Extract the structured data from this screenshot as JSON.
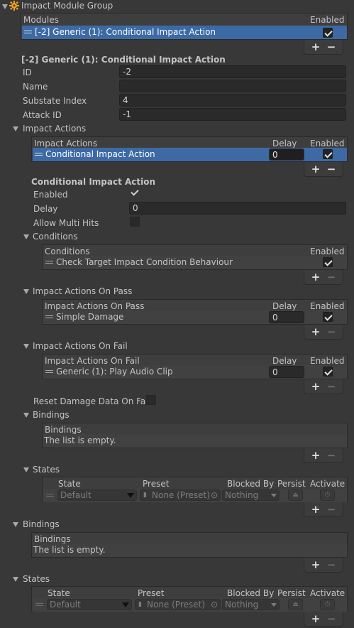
{
  "root": {
    "title": "Impact Module Group"
  },
  "modules": {
    "header": "Modules",
    "enabled_header": "Enabled",
    "items": [
      {
        "label": "[-2] Generic (1): Conditional Impact Action",
        "enabled": true
      }
    ]
  },
  "module_detail": {
    "title": "[-2] Generic (1): Conditional Impact Action",
    "fields": [
      {
        "label": "ID",
        "value": "-2"
      },
      {
        "label": "Name",
        "value": ""
      },
      {
        "label": "Substate Index",
        "value": "4"
      },
      {
        "label": "Attack ID",
        "value": "-1"
      }
    ]
  },
  "impact_actions": {
    "label": "Impact Actions",
    "header": "Impact Actions",
    "delay_header": "Delay",
    "enabled_header": "Enabled",
    "items": [
      {
        "label": "Conditional Impact Action",
        "delay": "0",
        "enabled": true
      }
    ]
  },
  "conditional_action": {
    "title": "Conditional Impact Action",
    "enabled_label": "Enabled",
    "enabled": true,
    "delay_label": "Delay",
    "delay_value": "0",
    "allow_multi_hits_label": "Allow Multi Hits",
    "allow_multi_hits": false
  },
  "conditions": {
    "label": "Conditions",
    "header": "Conditions",
    "enabled_header": "Enabled",
    "items": [
      {
        "label": "Check Target Impact Condition Behaviour",
        "enabled": true
      }
    ]
  },
  "on_pass": {
    "label": "Impact Actions On Pass",
    "header": "Impact Actions On Pass",
    "delay_header": "Delay",
    "enabled_header": "Enabled",
    "items": [
      {
        "label": "Simple Damage",
        "delay": "0",
        "enabled": true
      }
    ]
  },
  "on_fail": {
    "label": "Impact Actions On Fail",
    "header": "Impact Actions On Fail",
    "delay_header": "Delay",
    "enabled_header": "Enabled",
    "items": [
      {
        "label": "Generic (1): Play Audio Clip",
        "delay": "0",
        "enabled": true
      }
    ]
  },
  "reset_damage": {
    "label": "Reset Damage Data On Fail",
    "checked": false
  },
  "inner_bindings": {
    "label": "Bindings",
    "header": "Bindings",
    "empty_text": "The list is empty."
  },
  "inner_states": {
    "label": "States",
    "headers": {
      "state": "State",
      "preset": "Preset",
      "blocked_by": "Blocked By",
      "persist": "Persist",
      "activate": "Activate"
    },
    "row": {
      "state": "Default",
      "preset": "None (Preset)",
      "blocked_by": "Nothing"
    }
  },
  "outer_bindings": {
    "label": "Bindings",
    "header": "Bindings",
    "empty_text": "The list is empty."
  },
  "outer_states": {
    "label": "States",
    "headers": {
      "state": "State",
      "preset": "Preset",
      "blocked_by": "Blocked By",
      "persist": "Persist",
      "activate": "Activate"
    },
    "row": {
      "state": "Default",
      "preset": "None (Preset)",
      "blocked_by": "Nothing"
    }
  },
  "list_buttons": {
    "add": "+",
    "remove": "−"
  },
  "icons": [
    "gear-icon",
    "fold-arrow-icon",
    "drag-handle-icon",
    "checkmark-icon",
    "dropdown-arrow-icon",
    "object-icon",
    "target-icon",
    "upload-icon",
    "power-icon"
  ],
  "colors": {
    "background": "#383838",
    "selection": "#3d6aa5",
    "icon_accent": "#f0a020"
  }
}
